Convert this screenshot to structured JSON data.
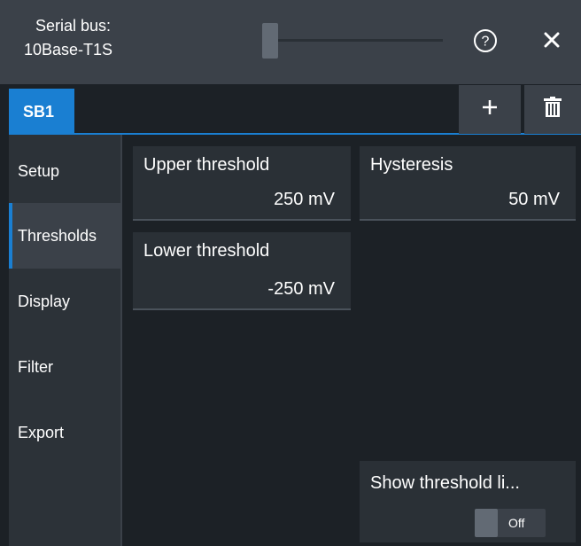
{
  "header": {
    "title_line1": "Serial bus:",
    "title_line2": "10Base-T1S",
    "help_icon": "question-circle-icon",
    "close_icon": "close-icon"
  },
  "tabs": {
    "active_label": "SB1",
    "add_icon": "plus-icon",
    "delete_icon": "trash-icon"
  },
  "sidebar": {
    "items": [
      {
        "label": "Setup",
        "active": false
      },
      {
        "label": "Thresholds",
        "active": true
      },
      {
        "label": "Display",
        "active": false
      },
      {
        "label": "Filter",
        "active": false
      },
      {
        "label": "Export",
        "active": false
      }
    ]
  },
  "fields": {
    "upper_threshold": {
      "label": "Upper threshold",
      "value": "250 mV"
    },
    "lower_threshold": {
      "label": "Lower threshold",
      "value": "-250 mV"
    },
    "hysteresis": {
      "label": "Hysteresis",
      "value": "50 mV"
    }
  },
  "show_threshold_lines": {
    "label": "Show threshold li...",
    "state": "Off"
  },
  "colors": {
    "accent": "#1a7fd2",
    "header_bg": "#3b4149",
    "panel_bg": "#1c2126",
    "field_bg": "#2a3036"
  }
}
